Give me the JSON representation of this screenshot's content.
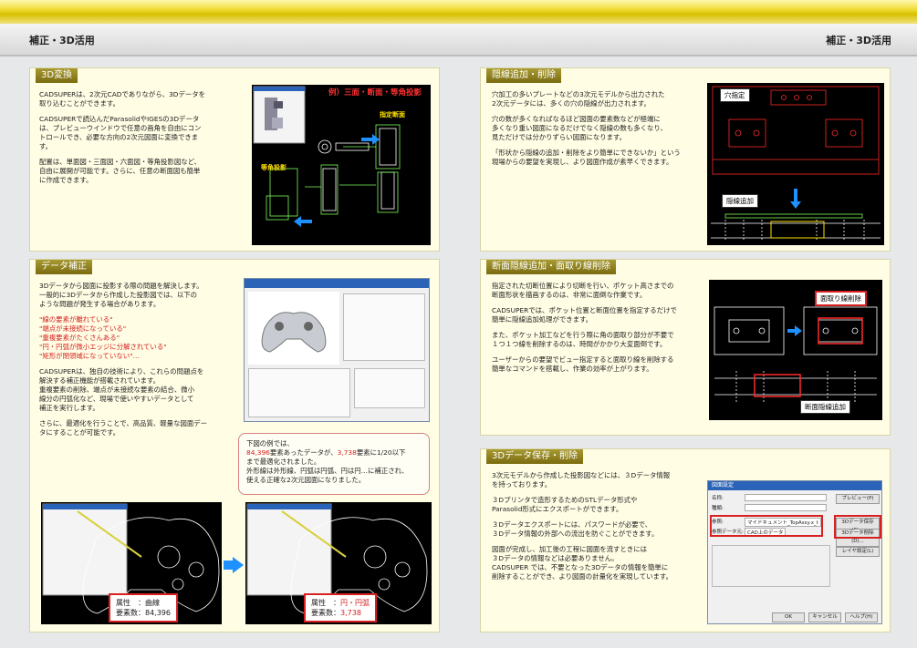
{
  "header": {
    "left_title": "補正・3D活用",
    "right_title": "補正・3D活用"
  },
  "panels": {
    "conv3d": {
      "title": "3D変換",
      "paragraphs": [
        "CADSUPERは、2次元CADでありながら、3Dデータを\n取り込むことができます。",
        "CADSUPERで読込んだParasolidやIGESの3Dデータ\nは、プレビューウインドウで任意の画角を自由にコン\nトロールでき、必要な方向の2次元図面に変換できま\nす。",
        "配置は、単面図・三面図・六面図・等角投影図など、\n自由に展開が可能です。さらに、任意の断面図も簡単\nに作成できます。"
      ],
      "fig_title": "例）三面・断面・等角投影",
      "fig_label_section": "指定断面",
      "fig_label_iso": "等角投影"
    },
    "hidden": {
      "title": "隠線追加・削除",
      "paragraphs": [
        "穴加工の多いプレートなどの3次元モデルから出力された\n2次元データには、多くの穴の隠線が出力されます。",
        "穴の数が多くなればなるほど図面の要素数などが極端に\n多くなり重い図面になるだけでなく隠線の数も多くなり、\n見ただけでは分かりずらい図面になります。",
        "「形状から隠線の追加・削除をより簡単にできないか」という\n現場からの要望を実現し、より図面作成が素早くできます。"
      ],
      "label_hole": "穴指定",
      "label_add": "隠線追加"
    },
    "fix": {
      "title": "データ補正",
      "paragraphs": [
        "3Dデータから図面に投影する際の問題を解決します。\n一般的に3Dデータから作成した投影図では、以下の\nような問題が発生する場合があります。"
      ],
      "problems": [
        "\"線の要素が離れている\"",
        "\"端点が未接続になっている\"",
        "\"重複要素がたくさんある\"",
        "\"円・円弧が微小エッジに分解されている\"",
        "\"矩形が閉領域になっていない\"…"
      ],
      "paragraphs2": [
        "CADSUPERは、独自の技術により、これらの問題点を\n解決する補正機能が搭載されています。\n重複要素の削除、端点が未接続な要素の結合、微小\n線分の円弧化など、現場で使いやすいデータとして\n補正を実行します。",
        "さらに、最適化を行うことで、高品質、軽量な図面デー\nタにすることが可能です。"
      ],
      "callout": {
        "line1": "下図の例では、",
        "count_before": "84,396",
        "mid1": "要素あったデータが、",
        "count_after": "3,738",
        "mid2": "要素に1/20以下\nまで最適化されました。\n外形線は外形線、円弧は円弧、円は円…に補正され、\n使える正確な2次元図面になりました。"
      },
      "before": {
        "attr_label": "属性　：曲線",
        "count_label": "要素数：84,396"
      },
      "after": {
        "attr_label_prefix": "属性　：",
        "attr_value": "円・円弧",
        "count_label_prefix": "要素数：",
        "count_value": "3,738"
      }
    },
    "section": {
      "title": "断面隠線追加・面取り線削除",
      "paragraphs": [
        "指定された切断位置により切断を行い、ポケット高さまでの\n断面形状を描画するのは、非常に面倒な作業です。",
        "CADSUPERでは、ポケット位置と断面位置を指定するだけで\n簡単に隠線追加処理ができます。",
        "また、ポケット加工などを行う際に角の面取り部分が不要で\n１つ１つ線を削除するのは、時間がかかり大変面倒です。",
        "ユーザーからの要望でビュー指定すると面取り線を削除する\n簡単なコマンドを搭載し、作業の効率が上がります。"
      ],
      "label_chamfer": "面取り線削除",
      "label_section": "断面隠線追加"
    },
    "save3d": {
      "title": "3Dデータ保存・削除",
      "paragraphs": [
        "3次元モデルから作成した投影図などには、３Dデータ情報\nを持っております。",
        "３Dプリンタで造形するためのSTLデータ形式や\nParasolid形式にエクスポートができます。",
        "３Dデータエクスポートには、パスワードが必要で、\n３Dデータ情報の外部への流出を防ぐことができます。",
        "図面が完成し、加工後の工程に図面を流すときには\n３Dデータの情報などは必要ありません。\nCADSUPER では、不要となった3Dデータの情報を簡単に\n削除することができ、より図面の計量化を実現しています。"
      ],
      "dialog": {
        "title": "図面設定",
        "btn_preview": "プレビュー(P)",
        "btn_save": "3Dデータ保存(E)...",
        "btn_delete": "3Dデータ削除(D)...",
        "btn_layer": "レイヤ設定(L)",
        "btn_ok": "OK",
        "btn_cancel": "キャンセル",
        "btn_help": "ヘルプ(H)",
        "field_name": "名称:",
        "field_kind": "種類:",
        "field_file": "参照:",
        "field_file_value": "マイドキュメント_TopAssy.x_t",
        "field_source": "参照データ元:",
        "field_source_value": "CAD上のデータ"
      }
    }
  },
  "colors": {
    "accent": "#7a6c10",
    "red": "#d42020",
    "cad_bg": "#000000"
  }
}
